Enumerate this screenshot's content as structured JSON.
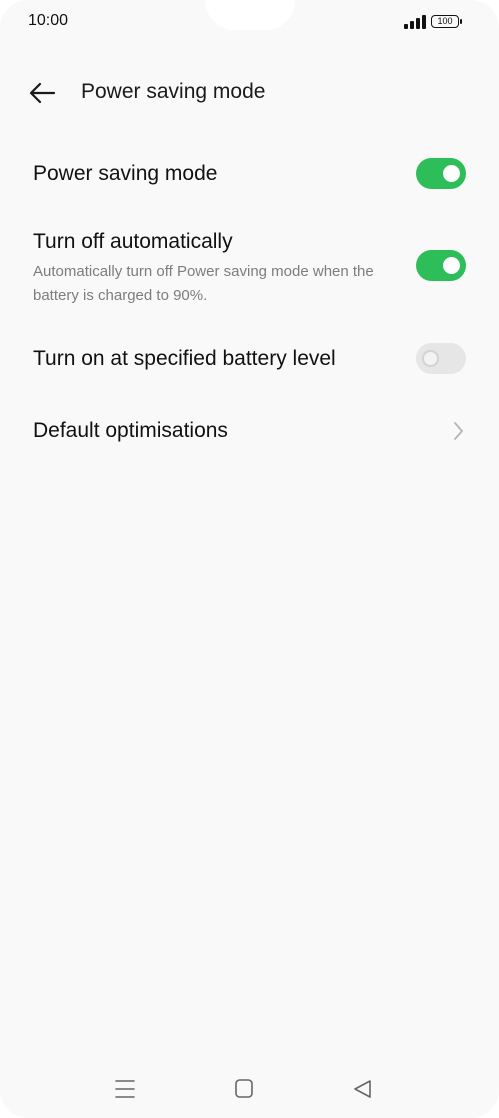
{
  "status_bar": {
    "time": "10:00",
    "battery_level": "100",
    "signal_icon": "signal-bars-icon",
    "battery_icon": "battery-icon"
  },
  "header": {
    "back_icon": "back-arrow-icon",
    "title": "Power saving mode"
  },
  "settings": [
    {
      "label": "Power saving mode",
      "control": "toggle",
      "state": "on"
    },
    {
      "label": "Turn off automatically",
      "subtitle": "Automatically turn off Power saving mode when the battery is charged to 90%.",
      "control": "toggle",
      "state": "on"
    },
    {
      "label": "Turn on at specified battery level",
      "control": "toggle",
      "state": "off"
    },
    {
      "label": "Default optimisations",
      "control": "chevron"
    }
  ],
  "nav_bar": {
    "menu_icon": "recent-apps-icon",
    "home_icon": "home-icon",
    "back_icon": "back-triangle-icon"
  },
  "colors": {
    "background": "#f9f9f9",
    "toggle_on": "#2dbe59",
    "toggle_off": "#e6e6e6",
    "text_primary": "#111111",
    "text_secondary": "#7d7d7d"
  }
}
